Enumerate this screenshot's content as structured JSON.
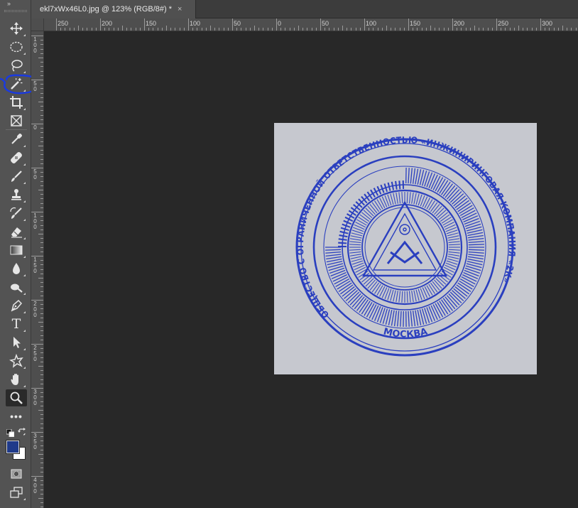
{
  "document": {
    "tab_title": "ekl7xWx46L0.jpg @ 123% (RGB/8#) *",
    "close_glyph": "×"
  },
  "toolbar": {
    "collapse_glyph": "››",
    "active_tool": "zoom",
    "tools": [
      "move-tool",
      "elliptical-marquee-tool",
      "lasso-tool",
      "magic-wand-tool",
      "crop-tool",
      "frame-tool",
      "eyedropper-tool",
      "healing-brush-tool",
      "brush-tool",
      "clone-stamp-tool",
      "history-brush-tool",
      "eraser-tool",
      "gradient-tool",
      "blur-tool",
      "dodge-tool",
      "pen-tool",
      "type-tool",
      "path-selection-tool",
      "custom-shape-tool",
      "hand-tool",
      "zoom-tool",
      "edit-toolbar",
      "quick-mask-mode",
      "screen-mode"
    ],
    "type_glyph": "T",
    "more_glyph": "•••",
    "foreground_color": "#1f3a8a",
    "background_color": "#ffffff",
    "annotation_color": "#1a3ae0"
  },
  "rulers": {
    "horizontal_labels": [
      "250",
      "200",
      "150",
      "100",
      "50",
      "0",
      "50",
      "100",
      "150",
      "200",
      "250",
      "300"
    ],
    "vertical_labels": [
      "100",
      "50",
      "0",
      "50",
      "100",
      "150",
      "200",
      "250",
      "300",
      "350",
      "400"
    ]
  },
  "stamp": {
    "outer_text": "ОБЩЕСТВО С ОГРАНИЧЕННОЙ ОТВЕТСТВЕННОСТЬЮ «ИНЖИНИРИНГОВАЯ КОМПАНИЯ «2К»",
    "city": "МОСКВА",
    "ink_color": "#2a3fbf",
    "paper_color": "#c6c8cf"
  }
}
